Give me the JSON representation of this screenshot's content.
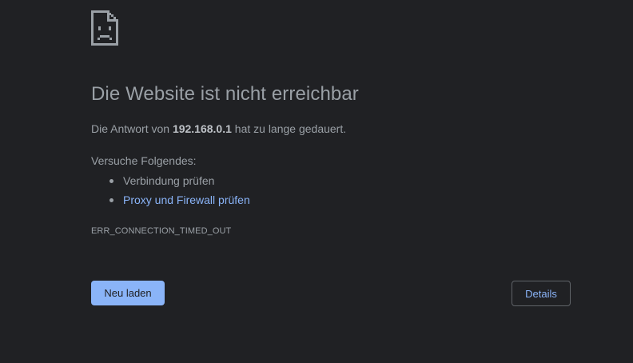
{
  "page": {
    "icon": "sad-page-icon",
    "headline": "Die Website ist nicht erreichbar",
    "summary": {
      "prefix": "Die Antwort von ",
      "host": "192.168.0.1",
      "suffix": " hat zu lange gedauert."
    },
    "suggestions_title": "Versuche Folgendes:",
    "suggestions": [
      {
        "label": "Verbindung prüfen",
        "is_link": false
      },
      {
        "label": "Proxy und Firewall prüfen",
        "is_link": true
      }
    ],
    "error_code": "ERR_CONNECTION_TIMED_OUT",
    "reload_label": "Neu laden",
    "details_label": "Details"
  },
  "colors": {
    "background": "#202124",
    "text": "#9aa0a6",
    "accent": "#8ab4f8",
    "button_border": "#5f6368"
  }
}
